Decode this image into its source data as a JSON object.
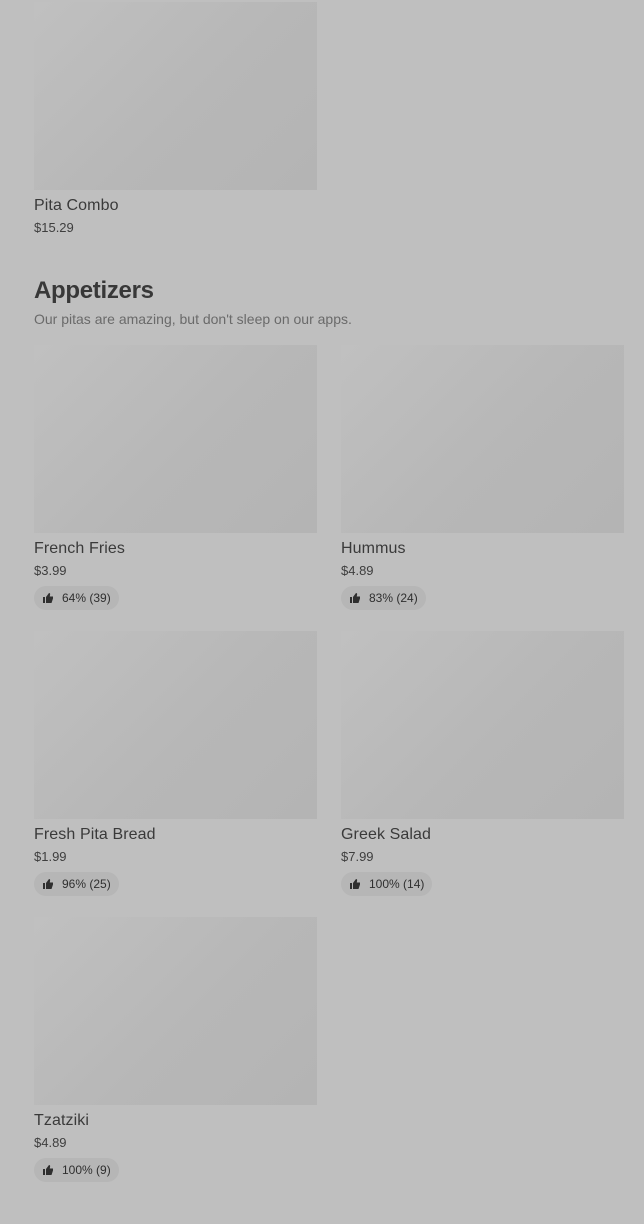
{
  "top_item": {
    "name": "Pita Combo",
    "price": "$15.29"
  },
  "section": {
    "title": "Appetizers",
    "subtitle": "Our pitas are amazing, but don't sleep on our apps."
  },
  "items": [
    {
      "name": "French Fries",
      "price": "$3.99",
      "rating": "64% (39)"
    },
    {
      "name": "Hummus",
      "price": "$4.89",
      "rating": "83% (24)"
    },
    {
      "name": "Fresh Pita Bread",
      "price": "$1.99",
      "rating": "96% (25)"
    },
    {
      "name": "Greek Salad",
      "price": "$7.99",
      "rating": "100% (14)"
    },
    {
      "name": "Tzatziki",
      "price": "$4.89",
      "rating": "100% (9)"
    }
  ],
  "icons": {
    "rating": "thumbs-up-icon"
  },
  "colors": {
    "overlay_background": "#bfbfbf",
    "badge_background": "#b6b6b6"
  }
}
